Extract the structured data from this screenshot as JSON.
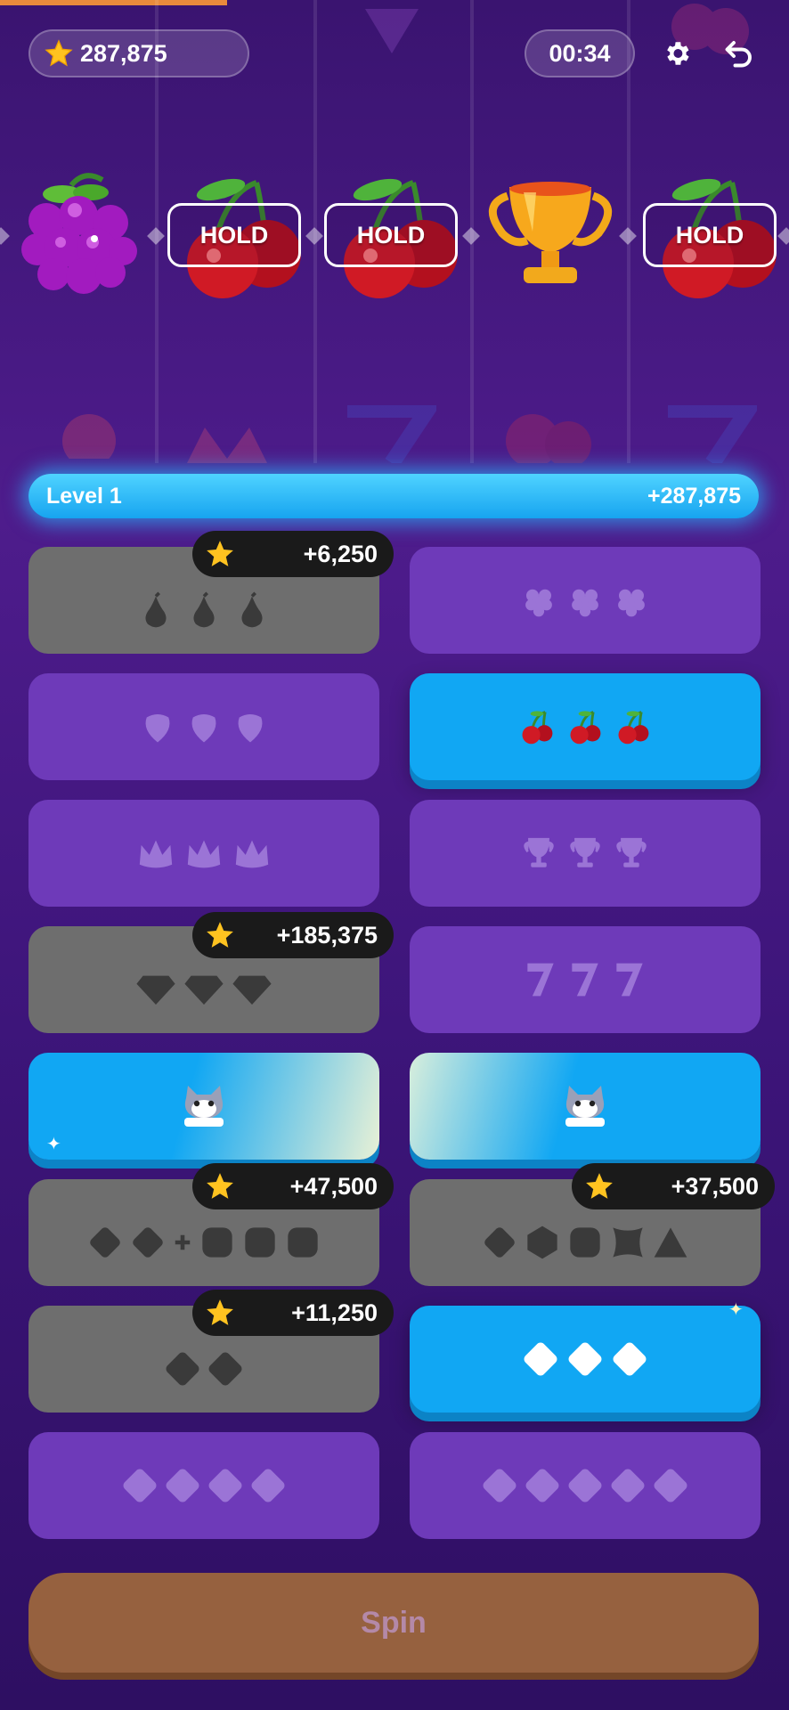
{
  "topbar": {
    "coins": "287,875",
    "timer": "00:34",
    "settings_icon": "gear-icon",
    "undo_icon": "undo-icon"
  },
  "reels": {
    "symbols": [
      "grape",
      "cherry",
      "cherry",
      "trophy",
      "cherry"
    ],
    "hold_label": "HOLD",
    "held": [
      false,
      true,
      true,
      false,
      true
    ]
  },
  "level": {
    "label": "Level 1",
    "points": "+287,875",
    "accent": "#17a4f0"
  },
  "paytable": {
    "badges": {
      "pears": "+6,250",
      "diamonds": "+185,375",
      "mixed_left": "+47,500",
      "mixed_right": "+37,500",
      "two_diamonds": "+11,250"
    },
    "rows": [
      [
        "pears (won)",
        "raspberries"
      ],
      [
        "strawberries",
        "cherries (active)"
      ],
      [
        "lotus",
        "trophies"
      ],
      [
        "gems (won)",
        "sevens"
      ],
      [
        "cat",
        "cat"
      ],
      [
        "two + three squares (won)",
        "shapes (won)"
      ],
      [
        "two diamonds (won)",
        "three diamonds (active)"
      ],
      [
        "four diamonds",
        "five diamonds"
      ]
    ],
    "colors": {
      "purple": "#6e3ab9",
      "gray": "#6e6e6e",
      "blue": "#11a7f3"
    }
  },
  "spin": {
    "label": "Spin",
    "color": "#96613f"
  }
}
